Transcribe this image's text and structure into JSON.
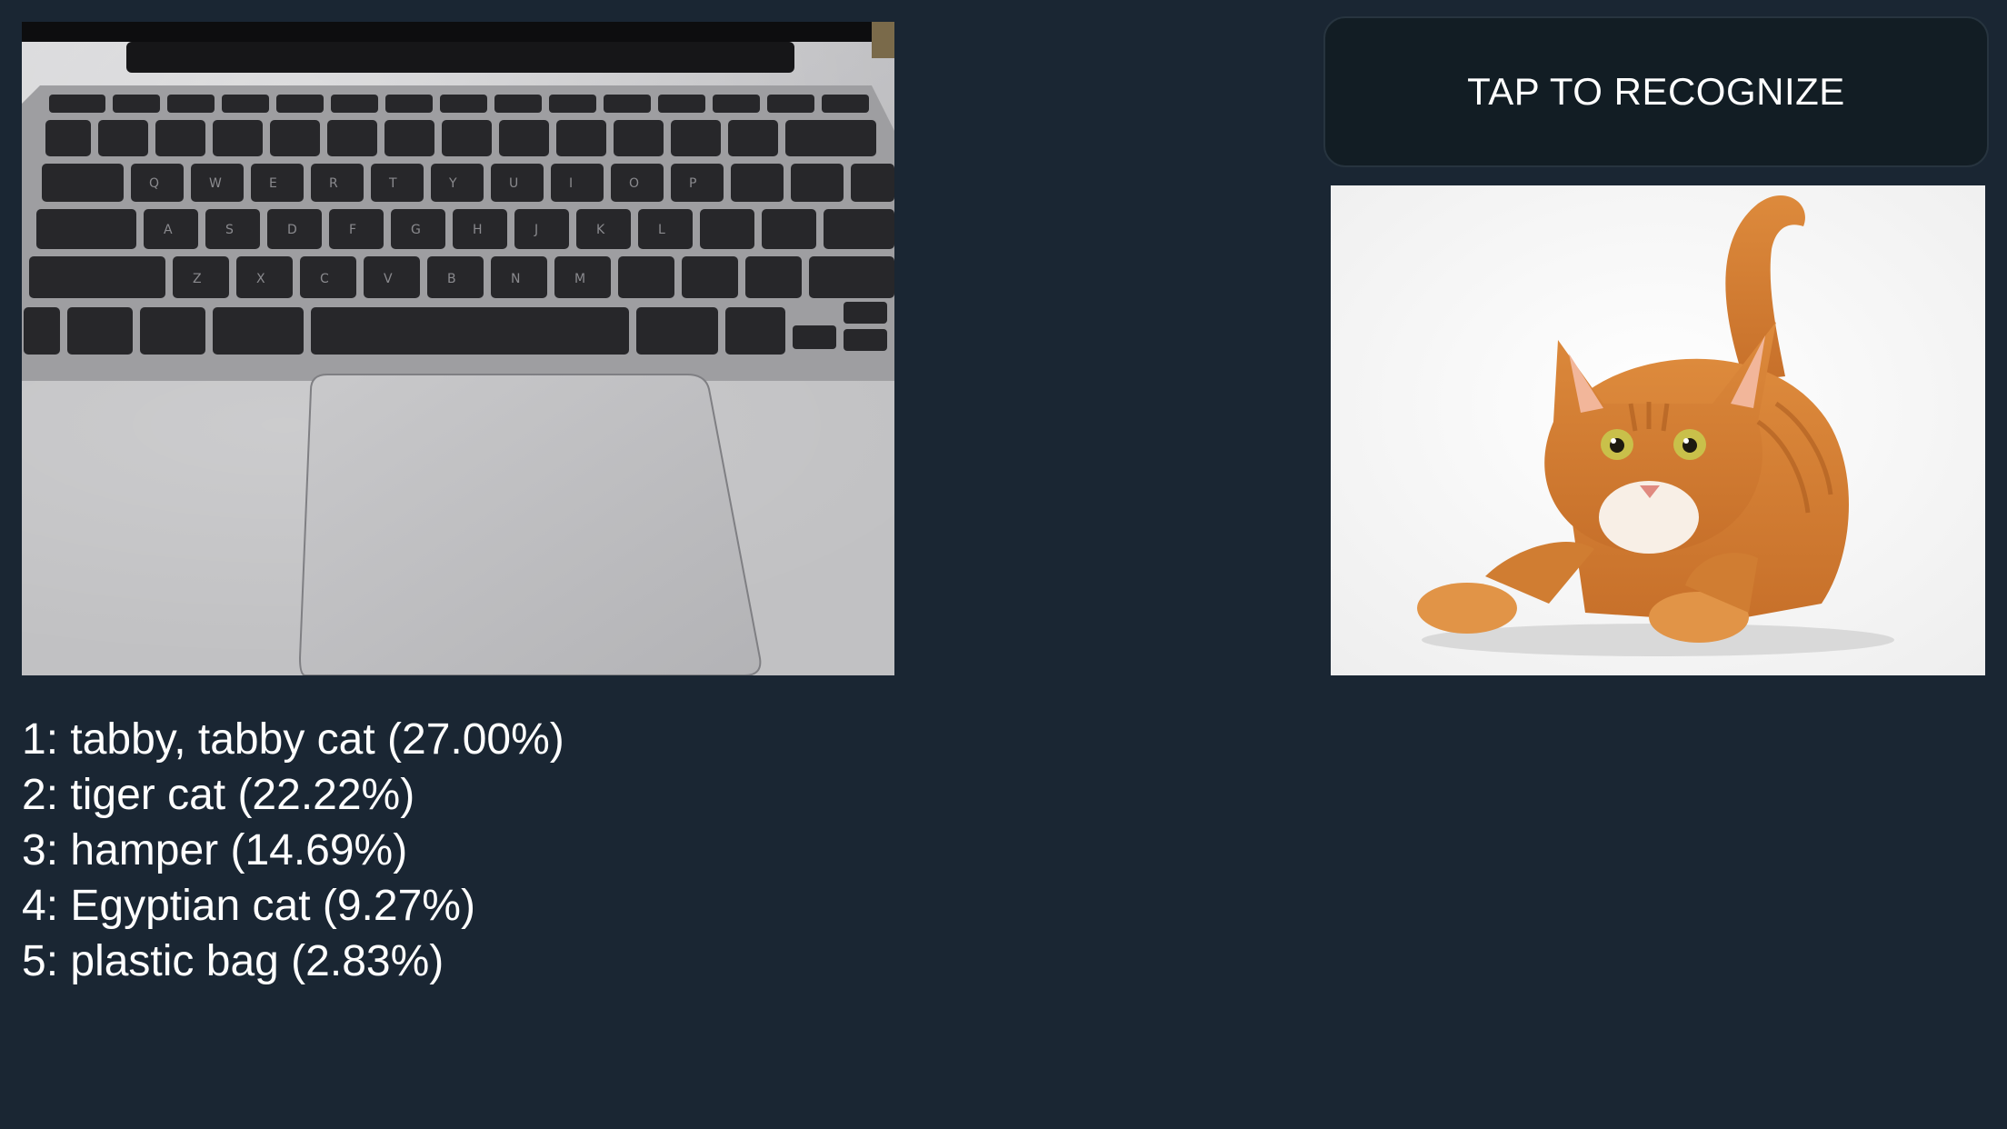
{
  "button": {
    "label": "TAP TO RECOGNIZE"
  },
  "camera_preview": {
    "icon": "laptop-keyboard-photo"
  },
  "sample_image": {
    "icon": "orange-tabby-cat-photo"
  },
  "results": [
    {
      "rank": "1",
      "label": "tabby, tabby cat",
      "confidence": "27.00%",
      "text": "1: tabby, tabby cat (27.00%)"
    },
    {
      "rank": "2",
      "label": "tiger cat",
      "confidence": "22.22%",
      "text": "2: tiger cat (22.22%)"
    },
    {
      "rank": "3",
      "label": "hamper",
      "confidence": "14.69%",
      "text": "3: hamper (14.69%)"
    },
    {
      "rank": "4",
      "label": "Egyptian cat",
      "confidence": "9.27%",
      "text": "4: Egyptian cat (9.27%)"
    },
    {
      "rank": "5",
      "label": "plastic bag",
      "confidence": "2.83%",
      "text": "5: plastic bag (2.83%)"
    }
  ],
  "colors": {
    "background": "#1a2633",
    "button_background": "#121d24",
    "button_border": "#27343f",
    "text": "#ffffff"
  }
}
